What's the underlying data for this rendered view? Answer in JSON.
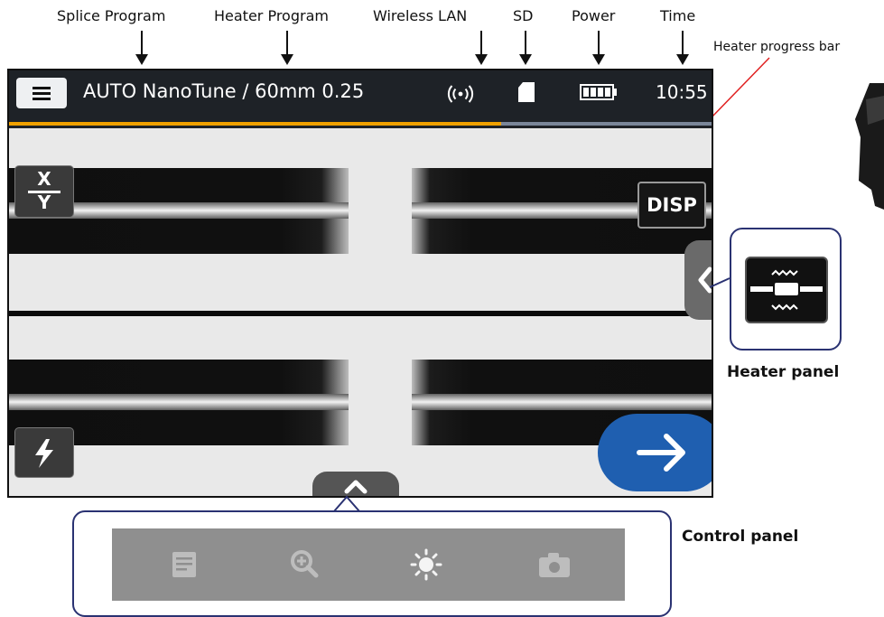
{
  "annotations": {
    "splice_program": "Splice Program",
    "heater_program": "Heater Program",
    "wireless_lan": "Wireless LAN",
    "sd": "SD",
    "power": "Power",
    "time": "Time",
    "heater_progress_bar": "Heater progress bar",
    "heater_panel": "Heater panel",
    "control_panel": "Control panel"
  },
  "status_bar": {
    "title": "AUTO NanoTune / 60mm 0.25",
    "wireless_icon": "wireless-signal-icon",
    "sd_icon": "sd-card-icon",
    "battery_icon": "battery-full-icon",
    "time": "10:55"
  },
  "heater_progress": {
    "fraction": 0.7,
    "fill_color": "#f0a100",
    "track_color": "#7a8699"
  },
  "view": {
    "xy_button": {
      "x": "X",
      "y": "Y"
    },
    "disp_button": "DISP",
    "arc_button_icon": "lightning-icon",
    "next_button_icon": "arrow-right-icon",
    "heater_tab_icon": "chevron-left-icon",
    "control_tab_icon": "chevron-up-icon"
  },
  "heater_panel": {
    "icon": "heater-icon"
  },
  "control_panel": {
    "icons": [
      "list-icon",
      "zoom-in-icon",
      "brightness-icon",
      "camera-icon"
    ]
  },
  "colors": {
    "status_bar_bg": "#1e2227",
    "next_button": "#1f5fb0",
    "callout_border": "#2a3272",
    "callout_line": "#e02020"
  }
}
